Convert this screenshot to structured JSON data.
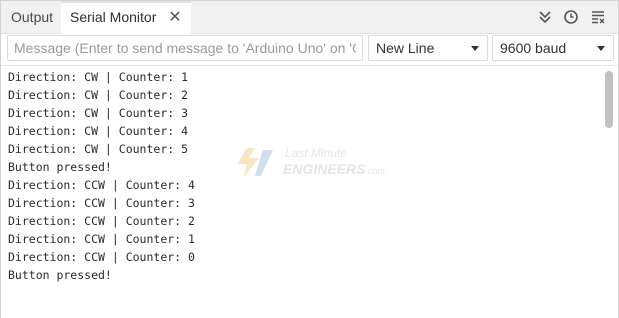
{
  "tabs": {
    "output_label": "Output",
    "serial_label": "Serial Monitor",
    "close_glyph": "✕"
  },
  "toolbar_icons": [
    "collapse-icon",
    "timestamp-icon",
    "clear-output-icon"
  ],
  "toolbar": {
    "message_placeholder": "Message (Enter to send message to 'Arduino Uno' on 'CO...",
    "line_ending": "New Line",
    "baud_rate": "9600 baud"
  },
  "watermark": {
    "line1": "Last Minute",
    "line2": "ENGINEERS",
    "suffix": ".com"
  },
  "output_lines": [
    "Direction: CW | Counter: 1",
    "Direction: CW | Counter: 2",
    "Direction: CW | Counter: 3",
    "Direction: CW | Counter: 4",
    "Direction: CW | Counter: 5",
    "Button pressed!",
    "Direction: CCW | Counter: 4",
    "Direction: CCW | Counter: 3",
    "Direction: CCW | Counter: 2",
    "Direction: CCW | Counter: 1",
    "Direction: CCW | Counter: 0",
    "Button pressed!"
  ],
  "colors": {
    "tabbar_bg": "#f1f1f1",
    "text": "#2a2a2a",
    "scrollbar": "#c1c1c1"
  }
}
